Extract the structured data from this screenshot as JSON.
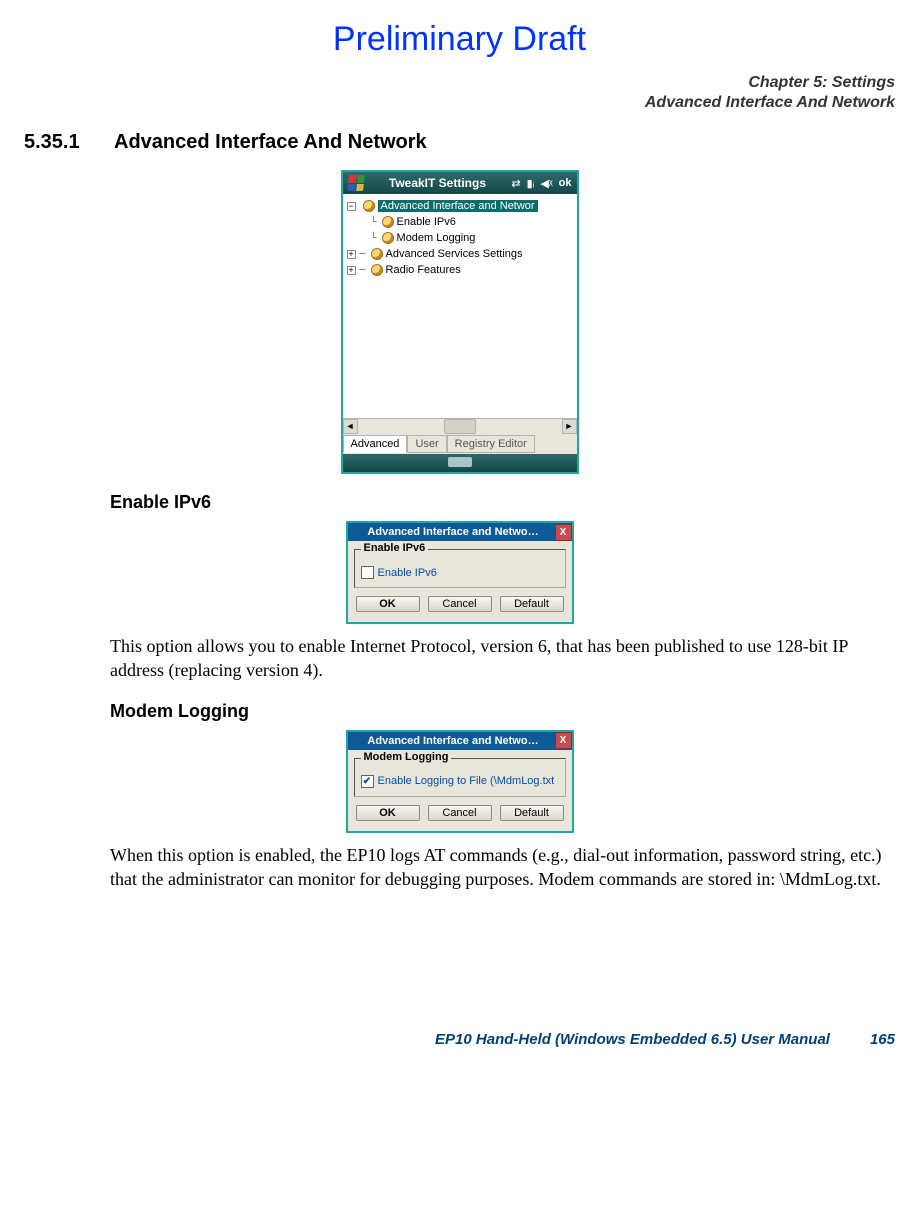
{
  "draft_label": "Preliminary Draft",
  "chapter_header": {
    "line1": "Chapter 5: Settings",
    "line2": "Advanced Interface And Network"
  },
  "section": {
    "number": "5.35.1",
    "title": "Advanced Interface And Network"
  },
  "screenshot1": {
    "titlebar": "TweakIT Settings",
    "ok": "ok",
    "tree": {
      "root": "Advanced Interface and Networ",
      "child1": "Enable IPv6",
      "child2": "Modem Logging",
      "n2": "Advanced Services Settings",
      "n3": "Radio Features"
    },
    "tabs": {
      "t1": "Advanced",
      "t2": "User",
      "t3": "Registry Editor"
    },
    "minus": "−",
    "plus": "+",
    "left_arrow": "◄",
    "right_arrow": "►"
  },
  "subhead_ipv6": "Enable IPv6",
  "dlg_ipv6": {
    "title": "Advanced Interface and Netwo…",
    "legend": "Enable IPv6",
    "check_label": "Enable IPv6",
    "check_mark": "",
    "close_x": "X"
  },
  "dlg_buttons": {
    "ok": "OK",
    "cancel": "Cancel",
    "default_": "Default"
  },
  "para_ipv6": "This option allows you to enable Internet Protocol, version 6, that has been published to use 128-bit IP address (replacing version 4).",
  "subhead_modem": "Modem Logging",
  "dlg_modem": {
    "title": "Advanced Interface and Netwo…",
    "legend": "Modem Logging",
    "check_label": "Enable Logging to File (\\MdmLog.txt",
    "check_mark": "✔",
    "close_x": "X"
  },
  "para_modem": "When this option is enabled, the EP10 logs AT commands (e.g., dial-out information, password string, etc.) that the administrator can monitor for debugging purposes. Modem commands are stored in: \\MdmLog.txt.",
  "footer": {
    "doc_title": "EP10 Hand-Held (Windows Embedded 6.5) User Manual",
    "page": "165"
  }
}
